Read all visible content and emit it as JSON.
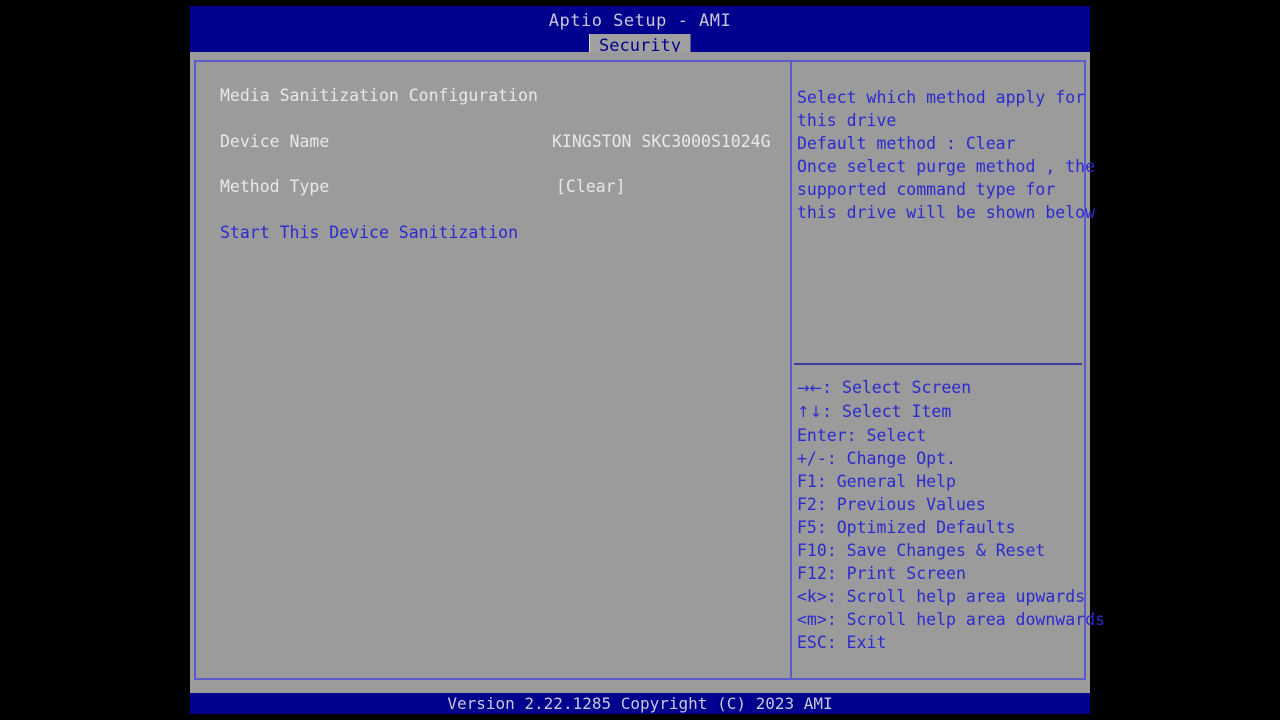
{
  "header": {
    "title": "Aptio Setup - AMI",
    "tabs": [
      {
        "label": "Security",
        "active": true
      }
    ]
  },
  "main": {
    "section_title": "Media Sanitization Configuration",
    "fields": [
      {
        "label": "Device Name",
        "value": "KINGSTON SKC3000S1024G"
      },
      {
        "label": "Method Type",
        "value": "[Clear]"
      }
    ],
    "action_label": "Start This Device Sanitization"
  },
  "help": {
    "lines": [
      "Select which method apply for",
      "this drive",
      "Default method : Clear",
      "Once select purge method , the",
      "supported command type for",
      "this drive will be shown below"
    ]
  },
  "key_legend": [
    {
      "keys": "→←",
      "text": ": Select Screen",
      "glyph": true
    },
    {
      "keys": "↑↓",
      "text": ": Select Item",
      "glyph": true
    },
    {
      "keys": "Enter",
      "text": ": Select",
      "glyph": false
    },
    {
      "keys": "+/-",
      "text": ": Change Opt.",
      "glyph": false
    },
    {
      "keys": "F1",
      "text": ": General Help",
      "glyph": false
    },
    {
      "keys": "F2",
      "text": ": Previous Values",
      "glyph": false
    },
    {
      "keys": "F5",
      "text": ": Optimized Defaults",
      "glyph": false
    },
    {
      "keys": "F10",
      "text": ": Save Changes & Reset",
      "glyph": false
    },
    {
      "keys": "F12",
      "text": ": Print Screen",
      "glyph": false
    },
    {
      "keys": "<k>",
      "text": ": Scroll help area upwards",
      "glyph": false
    },
    {
      "keys": "<m>",
      "text": ": Scroll help area downwards",
      "glyph": false
    },
    {
      "keys": "ESC",
      "text": ": Exit",
      "glyph": false
    }
  ],
  "footer": {
    "version_text": "Version 2.22.1285 Copyright (C) 2023 AMI"
  },
  "colors": {
    "header_blue": "#00008f",
    "panel_gray": "#9b9b9b",
    "border_blue": "#5a5ac8",
    "text_white": "#e8e8e8",
    "text_blue": "#2a2ad0",
    "tab_active_bg": "#a0a0a0"
  }
}
